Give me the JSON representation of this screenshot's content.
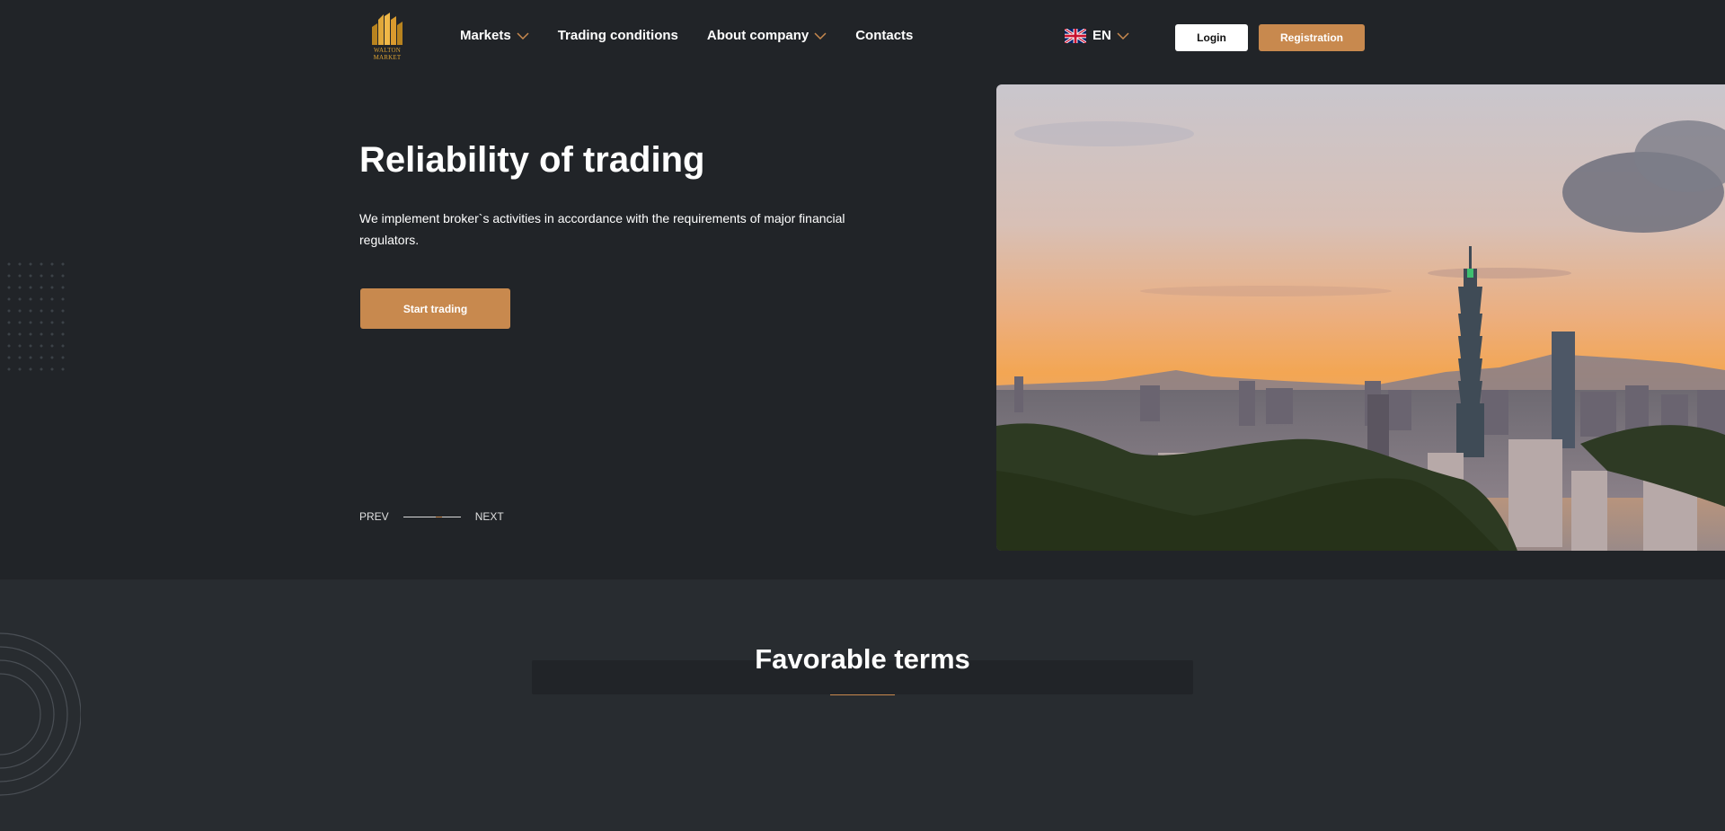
{
  "header": {
    "logo_line1": "WALTON",
    "logo_line2": "MARKET",
    "nav": [
      {
        "label": "Markets",
        "has_dropdown": true
      },
      {
        "label": "Trading conditions",
        "has_dropdown": false
      },
      {
        "label": "About company",
        "has_dropdown": true
      },
      {
        "label": "Contacts",
        "has_dropdown": false
      }
    ],
    "language": "EN",
    "language_flag": "uk-flag-icon",
    "login_label": "Login",
    "registration_label": "Registration"
  },
  "hero": {
    "title": "Reliability of trading",
    "description": "We implement broker`s activities in accordance with the requirements of major financial regulators.",
    "cta_label": "Start trading",
    "prev_label": "PREV",
    "next_label": "NEXT",
    "image": "taipei-skyline-sunset"
  },
  "favorable": {
    "title": "Favorable terms"
  },
  "colors": {
    "background": "#212428",
    "section_background": "#282c30",
    "accent": "#c8894e",
    "logo_gold": "#d9a033",
    "text": "#ffffff"
  }
}
